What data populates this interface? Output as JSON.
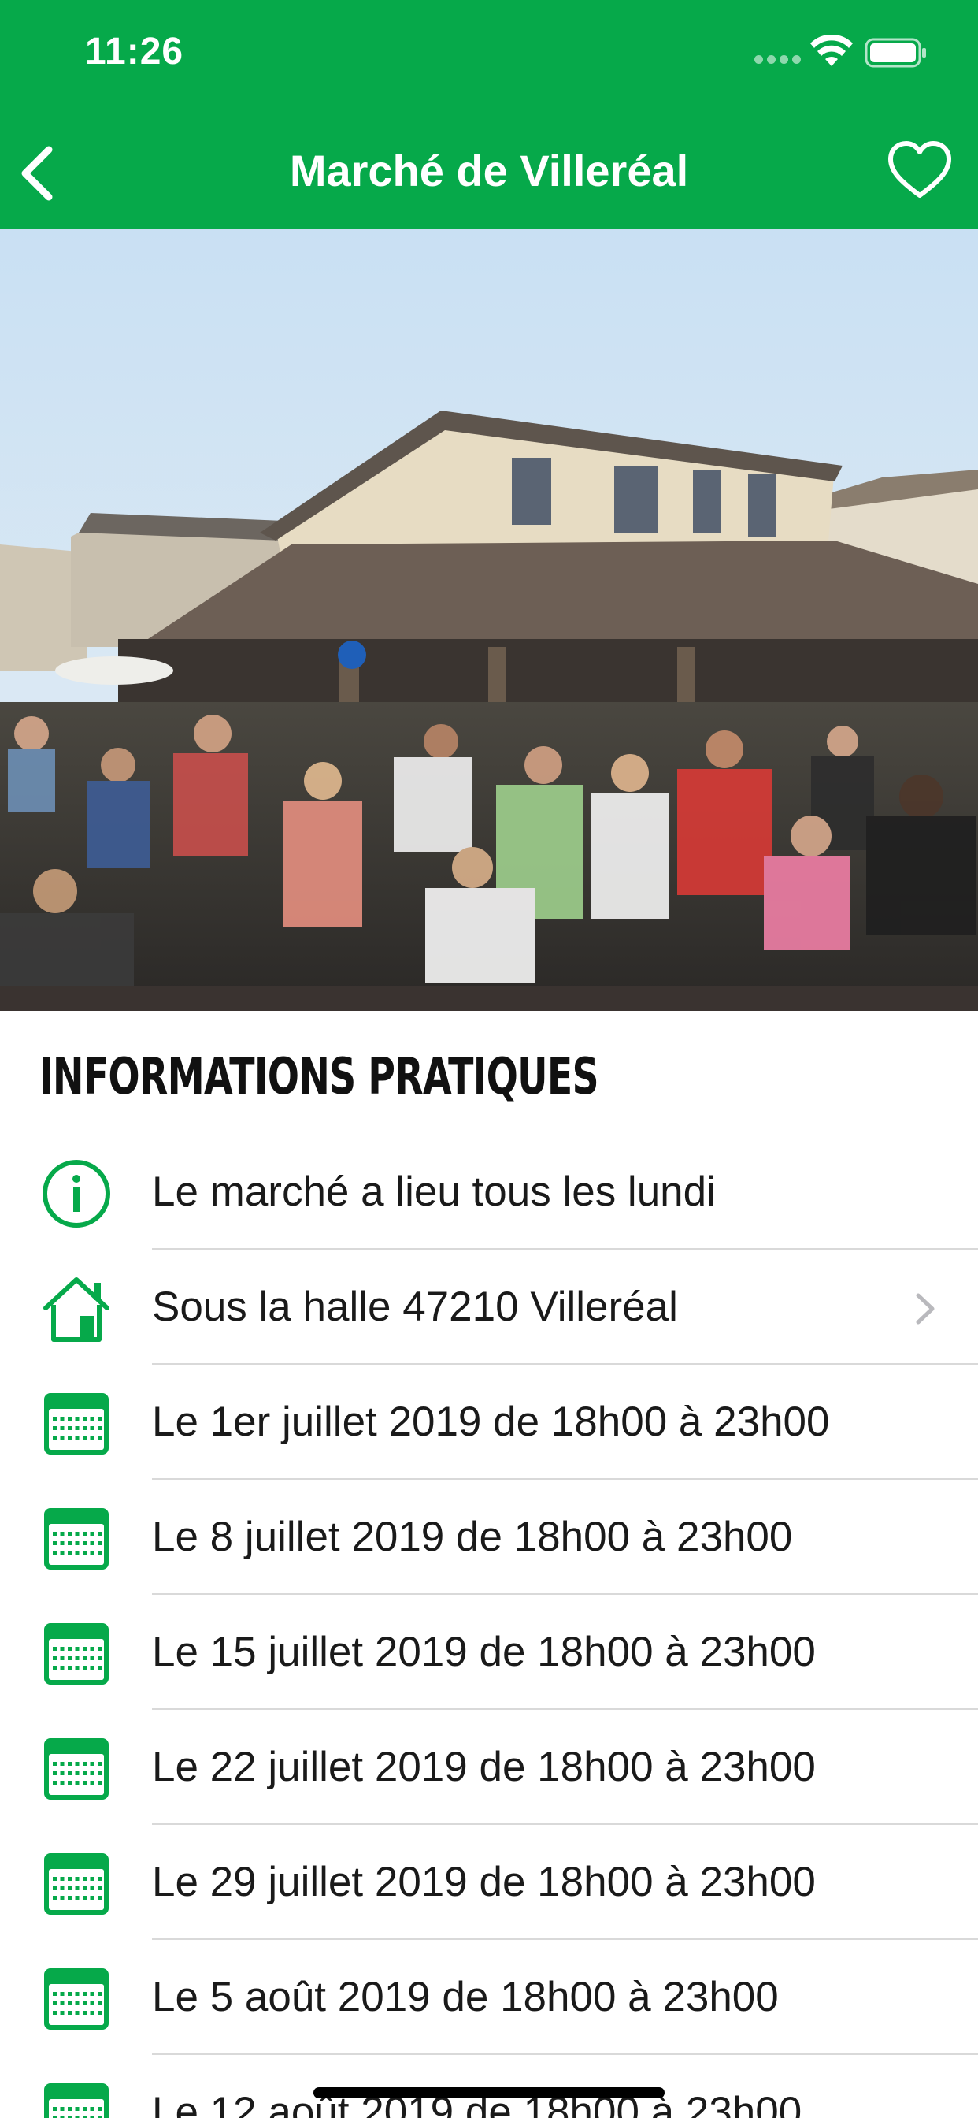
{
  "status_bar": {
    "time": "11:26"
  },
  "nav": {
    "title": "Marché de Villeréal",
    "back_icon": "chevron-left-icon",
    "favorite_icon": "heart-outline-icon"
  },
  "hero": {
    "image_icon": "market-photo"
  },
  "section": {
    "title": "INFORMATIONS PRATIQUES"
  },
  "info": {
    "schedule": {
      "icon": "info-icon",
      "text": "Le marché a lieu tous les lundi"
    },
    "address": {
      "icon": "home-icon",
      "text": "Sous la halle 47210 Villeréal"
    },
    "dates": [
      {
        "icon": "calendar-icon",
        "text": "Le 1er juillet 2019 de 18h00 à 23h00"
      },
      {
        "icon": "calendar-icon",
        "text": "Le 8 juillet 2019 de 18h00 à 23h00"
      },
      {
        "icon": "calendar-icon",
        "text": "Le 15 juillet 2019 de 18h00 à 23h00"
      },
      {
        "icon": "calendar-icon",
        "text": "Le 22 juillet 2019 de 18h00 à 23h00"
      },
      {
        "icon": "calendar-icon",
        "text": "Le 29 juillet 2019 de 18h00 à 23h00"
      },
      {
        "icon": "calendar-icon",
        "text": "Le 5 août 2019 de 18h00 à 23h00"
      },
      {
        "icon": "calendar-icon",
        "text": "Le 12 août 2019 de 18h00 à 23h00"
      }
    ]
  },
  "colors": {
    "brand_green": "#06a94a",
    "divider": "#d9d9d9"
  }
}
